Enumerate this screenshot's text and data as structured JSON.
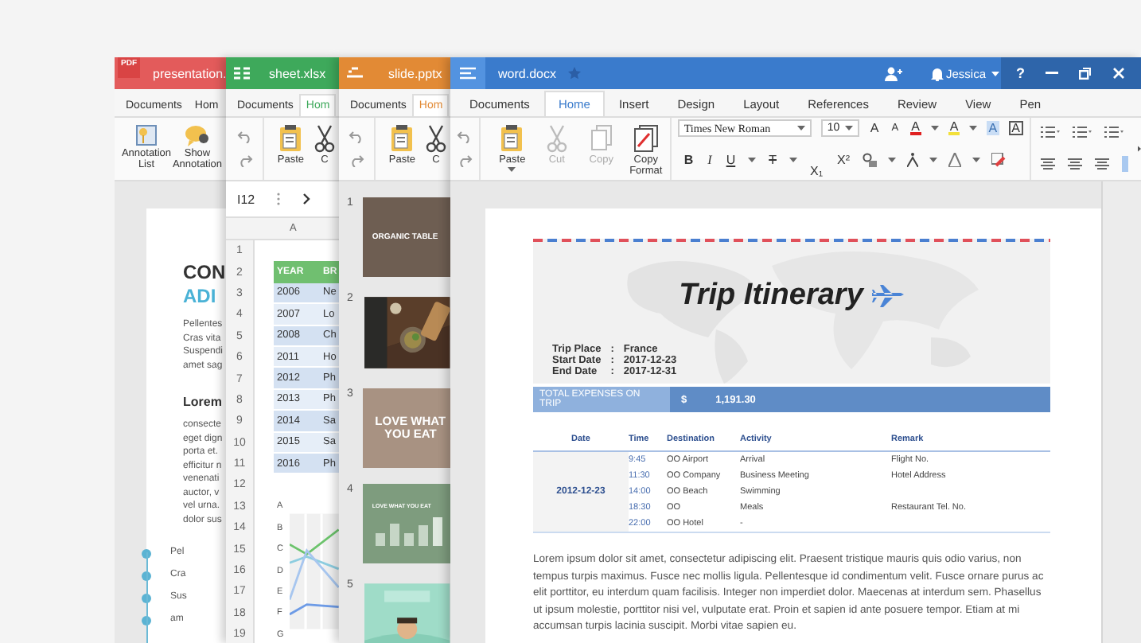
{
  "windows": [
    {
      "kind": "pdf",
      "badge": "PDF",
      "title": "presentation.",
      "color": "#e35b5b",
      "tabs": [
        {
          "label": "Documents",
          "selected": false
        },
        {
          "label": "Hom",
          "selected": false
        }
      ],
      "tools": [
        "Annotation List",
        "Show Annotation"
      ],
      "heading": [
        "CON",
        "ADI"
      ],
      "intro": [
        "Pellentes",
        "Cras vita",
        "Suspendi",
        "amet sag"
      ],
      "subheading": "Lorem",
      "body": [
        "consecte",
        "eget dign",
        "porta et.",
        "efficitur n",
        "venenati",
        "auctor, v",
        "vel urna.",
        "dolor sus"
      ],
      "bullets": [
        "Pel",
        "Cra",
        "Sus",
        "am"
      ]
    },
    {
      "kind": "sheet",
      "title": "sheet.xlsx",
      "color": "#3ea95b",
      "tabs": [
        {
          "label": "Documents",
          "selected": false
        },
        {
          "label": "Hom",
          "selected": true
        }
      ],
      "tools": [
        "Paste",
        "C"
      ],
      "cell_ref": "I12",
      "column": "A",
      "row_numbers": [
        "1",
        "2",
        "3",
        "4",
        "5",
        "6",
        "7",
        "8",
        "9",
        "10",
        "11",
        "12",
        "13",
        "14",
        "15",
        "16",
        "17",
        "18",
        "19"
      ],
      "table_header": [
        "YEAR",
        "BR"
      ],
      "table_rows": [
        [
          "2006",
          "Ne"
        ],
        [
          "2007",
          "Lo"
        ],
        [
          "2008",
          "Ch"
        ],
        [
          "2011",
          "Ho"
        ],
        [
          "2012",
          "Ph"
        ],
        [
          "2013",
          "Ph"
        ],
        [
          "2014",
          "Sa"
        ],
        [
          "2015",
          "Sa"
        ],
        [
          "2016",
          "Ph"
        ]
      ],
      "chart_labels": [
        "A",
        "B",
        "C",
        "D",
        "E",
        "F",
        "G"
      ]
    },
    {
      "kind": "slide",
      "title": "slide.pptx",
      "color": "#e28a35",
      "tabs": [
        {
          "label": "Documents",
          "selected": false
        },
        {
          "label": "Hom",
          "selected": true
        }
      ],
      "tools": [
        "Paste",
        "C"
      ],
      "slides": [
        {
          "number": "1",
          "kind": "title",
          "color": "#6e5e52",
          "title": "ORGANIC TABLE"
        },
        {
          "number": "2",
          "kind": "picture"
        },
        {
          "number": "3",
          "kind": "title",
          "color": "#a89282",
          "title": "LOVE WHAT YOU EAT"
        },
        {
          "number": "4",
          "kind": "chart",
          "color": "#7e9c7e",
          "title": "LOVE WHAT YOU EAT"
        },
        {
          "number": "5",
          "kind": "picture"
        }
      ]
    },
    {
      "kind": "word",
      "title": "word.docx",
      "color": "#3a7bcc",
      "user": "Jessica",
      "help": "?",
      "tabs": [
        {
          "label": "Documents",
          "selected": false
        },
        {
          "label": "Home",
          "selected": true
        },
        {
          "label": "Insert",
          "selected": false
        },
        {
          "label": "Design",
          "selected": false
        },
        {
          "label": "Layout",
          "selected": false
        },
        {
          "label": "References",
          "selected": false
        },
        {
          "label": "Review",
          "selected": false
        },
        {
          "label": "View",
          "selected": false
        },
        {
          "label": "Pen",
          "selected": false
        }
      ],
      "clipboard": [
        {
          "kind": "paste",
          "label": "Paste",
          "disabled": false
        },
        {
          "kind": "cut",
          "label": "Cut",
          "disabled": true
        },
        {
          "kind": "copy",
          "label": "Copy",
          "disabled": true
        },
        {
          "kind": "format",
          "label": "Copy Format",
          "disabled": false
        }
      ],
      "font": "Times New Roman",
      "size": "10",
      "font_tools": [
        {
          "kind": "grow",
          "label": "A"
        },
        {
          "kind": "shrink",
          "label": "A"
        },
        {
          "kind": "color",
          "label": "A"
        },
        {
          "kind": "highlight",
          "label": "A"
        },
        {
          "kind": "shade",
          "label": "A"
        },
        {
          "kind": "border",
          "label": "A"
        }
      ],
      "format_tools": [
        {
          "kind": "bold",
          "label": "B"
        },
        {
          "kind": "italic",
          "label": "I"
        },
        {
          "kind": "underline",
          "label": "U"
        },
        {
          "kind": "strike",
          "label": "T"
        },
        {
          "kind": "sub",
          "label": "X₁"
        },
        {
          "kind": "sup",
          "label": "X²"
        }
      ],
      "document": {
        "title": "Trip Itinerary",
        "details": [
          {
            "label": "Trip Place",
            "separator": ":",
            "value": "France"
          },
          {
            "label": "Start Date",
            "separator": ":",
            "value": "2017-12-23"
          },
          {
            "label": "End Date",
            "separator": ":",
            "value": "2017-12-31"
          }
        ],
        "total": {
          "label": "TOTAL EXPENSES ON TRIP",
          "currency": "$",
          "amount": "1,191.30"
        },
        "table": {
          "columns": [
            "Date",
            "Time",
            "Destination",
            "Activity",
            "Remark"
          ],
          "rows": [
            [
              "",
              "9:45",
              "OO Airport",
              "Arrival",
              "Flight No."
            ],
            [
              "",
              "11:30",
              "OO Company",
              "Business Meeting",
              "Hotel Address"
            ],
            [
              "2012-12-23",
              "14:00",
              "OO Beach",
              "Swimming",
              ""
            ],
            [
              "",
              "18:30",
              "OO",
              "Meals",
              "Restaurant Tel. No."
            ],
            [
              "",
              "22:00",
              "OO Hotel",
              "-",
              ""
            ]
          ]
        },
        "paragraph": "Lorem ipsum dolor sit amet, consectetur adipiscing elit. Praesent tristique mauris quis odio varius, non tempus turpis maximus. Fusce nec mollis ligula. Pellentesque id condimentum velit. Fusce ornare purus ac elit porttitor, eu interdum quam facilisis. Integer non imperdiet dolor. Maecenas at interdum sem. Phasellus ut ipsum molestie, porttitor nisi vel, vulputate erat. Proin et sapien id ante posuere tempor. Etiam at mi accumsan turpis lacinia suscipit. Morbi vitae sapien eu."
      }
    }
  ]
}
